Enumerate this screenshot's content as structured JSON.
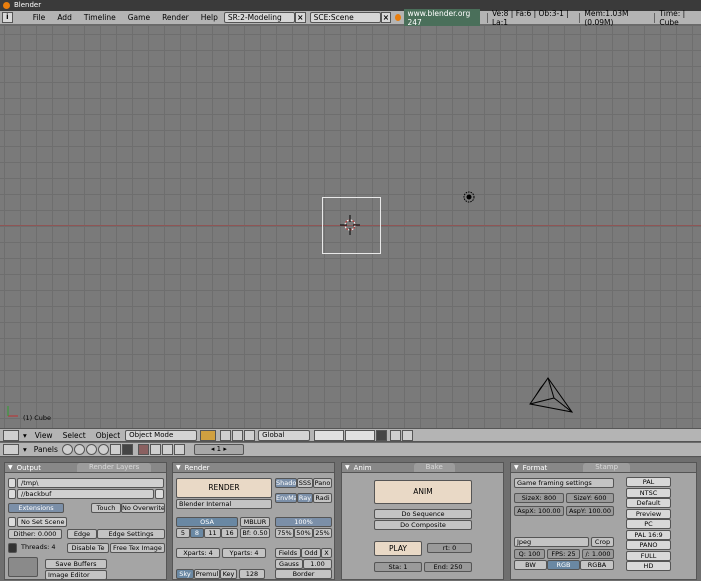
{
  "window": {
    "title": "Blender"
  },
  "topbar": {
    "info": "i",
    "menus": [
      "File",
      "Add",
      "Timeline",
      "Game",
      "Render",
      "Help"
    ],
    "screen": "SR:2-Modeling",
    "scene": "SCE:Scene",
    "url": "www.blender.org 247",
    "stats": "Ve:8 | Fa:6 | Ob:3-1 | La:1",
    "mem": "Mem:1.03M (0.09M)",
    "time": "Time: | Cube"
  },
  "viewport": {
    "label": "(1) Cube"
  },
  "vpheader": {
    "menus": [
      "View",
      "Select",
      "Object"
    ],
    "mode": "Object Mode",
    "orientation": "Global"
  },
  "btnheader": {
    "panels_label": "Panels",
    "frame": "1"
  },
  "output": {
    "title": "Output",
    "tab2": "Render Layers",
    "path1": "/tmp\\",
    "path2": "//backbuf",
    "extensions": "Extensions",
    "touch": "Touch",
    "no_overwrite": "No Overwrite",
    "no_set_scene": "No Set Scene",
    "dither": "Dither: 0.000",
    "edge": "Edge",
    "edge_settings": "Edge Settings",
    "threads": "Threads: 4",
    "disable_tex": "Disable Te",
    "free_tex": "Free Tex Image",
    "save_buffers": "Save Buffers",
    "image_editor": "Image Editor"
  },
  "render": {
    "title": "Render",
    "render_btn": "RENDER",
    "engine": "Blender Internal",
    "shadow": "Shado",
    "sss": "SSS",
    "pano": "Pano",
    "envmap": "EnvMa",
    "ray": "Ray",
    "radio": "Radi",
    "osa": "OSA",
    "mblur": "MBLUR",
    "pct100": "100%",
    "osa_values": [
      "5",
      "8",
      "11",
      "16"
    ],
    "bf": "Bf: 0.50",
    "pct_values": [
      "75%",
      "50%",
      "25%"
    ],
    "xparts": "Xparts: 4",
    "yparts": "Yparts: 4",
    "fields": "Fields",
    "odd": "Odd",
    "x": "X",
    "gauss": "Gauss",
    "gauss_val": "1.00",
    "sky": "Sky",
    "premul": "Premul",
    "key": "Key",
    "bits": "128",
    "border": "Border"
  },
  "anim": {
    "title": "Anim",
    "tab2": "Bake",
    "anim_btn": "ANIM",
    "do_sequence": "Do Sequence",
    "do_composite": "Do Composite",
    "play": "PLAY",
    "rt": "rt: 0",
    "sta": "Sta: 1",
    "end": "End: 250"
  },
  "format": {
    "title": "Format",
    "tab2": "Stamp",
    "game_framing": "Game framing settings",
    "sizex": "SizeX: 800",
    "sizey": "SizeY: 600",
    "aspx": "AspX: 100.00",
    "aspy": "AspY: 100.00",
    "filetype": "Jpeg",
    "crop": "Crop",
    "quality": "Q: 100",
    "fps": "FPS: 25",
    "fps_base": "/: 1.000",
    "bw": "BW",
    "rgb": "RGB",
    "rgba": "RGBA",
    "presets": [
      "PAL",
      "NTSC",
      "Default",
      "Preview",
      "PC",
      "PAL 16:9",
      "PANO",
      "FULL",
      "HD"
    ]
  },
  "colors": {
    "accent_orange": "#e87d0d",
    "grid": "#7a7a7a",
    "panel": "#a5a5a5"
  }
}
